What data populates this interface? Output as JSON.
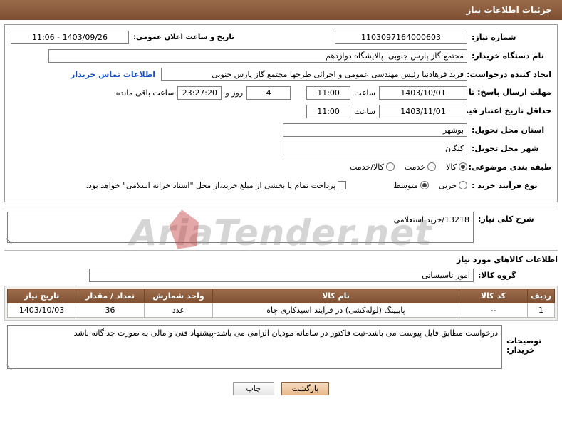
{
  "header": {
    "title": "جزئیات اطلاعات نیاز"
  },
  "form": {
    "request_number_label": "شماره نیاز:",
    "request_number_value": "1103097164000603",
    "announce_datetime_label": "تاریخ و ساعت اعلان عمومی:",
    "announce_datetime_value": "1403/09/26 - 11:06",
    "requester_device_label": "نام دستگاه خریدار:",
    "requester_device_value": "مجتمع گاز پارس جنوبی  پالایشگاه دوازدهم",
    "creator_label": "ایجاد کننده درخواست:",
    "creator_value": "فرید فرهادنیا رئیس مهندسی عمومی و اجرائی طرحها مجتمع گاز پارس جنوبی",
    "contact_button": "اطلاعات تماس خریدار",
    "reply_deadline_label": "مهلت ارسال پاسخ: تا تاریخ:",
    "reply_deadline_date": "1403/10/01",
    "hour_label": "ساعت",
    "reply_deadline_time": "11:00",
    "remaining_days": "4",
    "days_and_label": "روز و",
    "remaining_time": "23:27:20",
    "remaining_suffix": "ساعت باقی مانده",
    "price_validity_label": "حداقل تاریخ اعتبار قیمت: تا تاریخ:",
    "price_validity_date": "1403/11/01",
    "price_validity_hour_label": "ساعت",
    "price_validity_time": "11:00",
    "province_label": "استان محل تحویل:",
    "province_value": "بوشهر",
    "city_label": "شهر محل تحویل:",
    "city_value": "کنگان",
    "category_label": "طبقه بندی موضوعی:",
    "category_options": [
      {
        "label": "کالا",
        "selected": true
      },
      {
        "label": "خدمت",
        "selected": false
      },
      {
        "label": "کالا/خدمت",
        "selected": false
      }
    ],
    "process_type_label": "نوع فرآیند خرید :",
    "process_type_options": [
      {
        "label": "جزیی",
        "selected": false
      },
      {
        "label": "متوسط",
        "selected": true
      }
    ],
    "payment_checkbox_label": "پرداخت تمام یا بخشی از مبلغ خرید،از محل \"اسناد خزانه اسلامی\" خواهد بود.",
    "payment_checkbox_checked": false
  },
  "summary": {
    "label": "شرح کلی نیاز:",
    "value": "13218/خرید استعلامی"
  },
  "goods_section": {
    "title": "اطلاعات کالاهای مورد نیاز",
    "group_label": "گروه کالا:",
    "group_value": "امور تاسیساتی"
  },
  "table": {
    "columns": [
      "ردیف",
      "کد کالا",
      "نام کالا",
      "واحد شمارش",
      "تعداد / مقدار",
      "تاریخ نیاز"
    ],
    "rows": [
      {
        "row": "1",
        "code": "--",
        "name": "پایپینگ (لوله‌کشی) در فرآیند اسیدکاری چاه",
        "unit": "عدد",
        "qty": "36",
        "date": "1403/10/03"
      }
    ]
  },
  "notes": {
    "label": "توضیحات خریدار:",
    "value": "درخواست مطابق فایل پیوست می باشد-ثبت فاکتور در سامانه مودیان الزامی می باشد-پیشنهاد فنی و مالی به صورت جداگانه باشد"
  },
  "footer": {
    "back_button": "بازگشت",
    "print_button": "چاپ"
  },
  "watermark": {
    "text": "AriaTender.net"
  }
}
